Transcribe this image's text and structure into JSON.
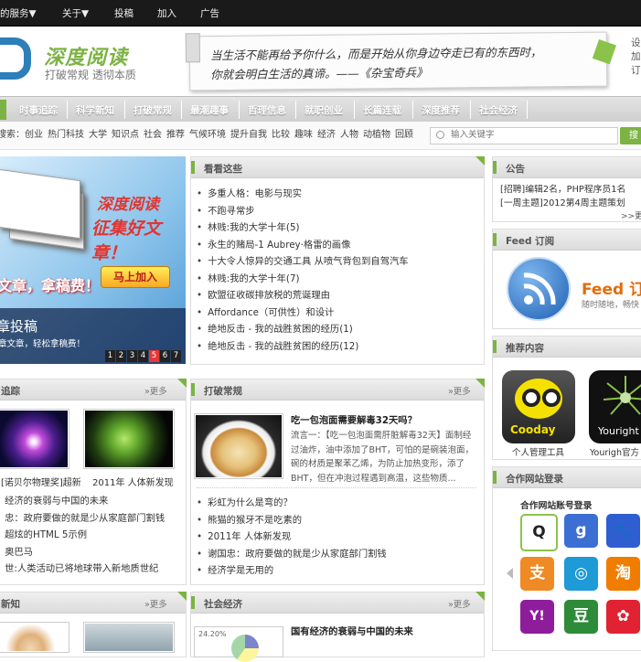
{
  "topnav": {
    "items": [
      "的服务▼",
      "关于▼",
      "投稿",
      "加入",
      "广告"
    ]
  },
  "header": {
    "logo_title": "深度阅读",
    "logo_sub": "打破常规 透彻本质",
    "quote_line1": "当生活不能再给予你什么，而是开始从你身边夺走已有的东西时，",
    "quote_line2": "你就会明白生活的真谛。——《杂宝奇兵》",
    "right_links": [
      "设",
      "加",
      "订"
    ]
  },
  "nav": {
    "items": [
      "时事追踪",
      "科学新知",
      "打破常规",
      "最潮趣事",
      "哲理信息",
      "就职创业",
      "长篇连载",
      "深度推荐",
      "社会经济"
    ]
  },
  "search": {
    "keywords_label": "搜索：",
    "keywords": [
      "创业",
      "热门科技",
      "大学",
      "知识点",
      "社会",
      "推荐",
      "气候环境",
      "提升自我",
      "比较",
      "趣味",
      "经济",
      "人物",
      "动植物",
      "回顾"
    ],
    "placeholder": "输入关键字",
    "button": "搜"
  },
  "banner": {
    "headline1": "深度阅读",
    "headline2": "征集好文章！",
    "left_text": "文章，拿稿费！",
    "join_button": "马上加入",
    "caption_title": "章投稿",
    "caption_sub": "章文章，轻松拿稿费！",
    "pages": [
      "1",
      "2",
      "3",
      "4",
      "5",
      "6",
      "7"
    ]
  },
  "kankan": {
    "title": "看看这些",
    "items": [
      "多重人格：电影与现实",
      "不跑寻常步",
      "林贱:我的大学十年(5)",
      "永生的赌局-1 Aubrey·格雷的画像",
      "十大令人惊异的交通工具 从喷气背包到自驾汽车",
      "林贱:我的大学十年(7)",
      "欧盟征收碳排放税的荒诞理由",
      "Affordance（可供性）和设计",
      "绝地反击 - 我的战胜贫困的经历(1)",
      "绝地反击 - 我的战胜贫困的经历(12)"
    ]
  },
  "notice": {
    "title": "公告",
    "items": [
      "[招聘]编辑2名，PHP程序员1名",
      "[一周主题]2012第4周主题策划"
    ],
    "more": ">>更"
  },
  "feed": {
    "title": "Feed 订阅",
    "logo": "Feed 订",
    "sub": "随时随地，畅快"
  },
  "recommend": {
    "title": "推荐内容",
    "apps": [
      "个人管理工具",
      "Yourigh官方"
    ],
    "app1_label": "Cooday",
    "app2_label": "Youright"
  },
  "shishi": {
    "title": "追踪",
    "more": "»更多",
    "thumb_caps": [
      "[诺贝尔物理奖]超新",
      "2011年 人体新发现"
    ],
    "items": [
      "经济的衰弱与中国的未来",
      "忠：政府要做的就是少从家庭部门割钱",
      "超炫的HTML 5示例",
      "奥巴马",
      "世:人类活动已将地球带入新地质世纪"
    ]
  },
  "dapo": {
    "title": "打破常规",
    "more": "»更多",
    "feature_title": "吃一包泡面需要解毒32天吗？",
    "feature_text": [
      "流言一：【吃一包泡面需肝脏解毒32天】面制经",
      "过油炸，油中添加了BHT，可怕的是碗装泡面，",
      "碗的材质是聚苯乙烯，为防止加热变形，添了",
      "BHT，但在冲泡过程遇到高温，这些物质..."
    ],
    "items": [
      "彩虹为什么是弯的？",
      "熊猫的猴牙不是吃素的",
      "2011年 人体新发现",
      "谢国忠：政府要做的就是少从家庭部门割钱",
      "经济学是无用的"
    ]
  },
  "shehui": {
    "title": "社会经济",
    "more": "»更多",
    "feature_title": "国有经济的衰弱与中国的未来",
    "chart_label": "24.20%"
  },
  "kexue": {
    "title": "新知",
    "more": "»更多"
  },
  "partner": {
    "title": "合作网站登录",
    "heading": "合作网站账号登录",
    "icons": [
      "Q",
      "g",
      "🐾",
      "支",
      "◎",
      "淘",
      "Y!",
      "豆",
      "✿"
    ]
  },
  "colors": {
    "accent": "#7cb342",
    "top": "#1a1a1a",
    "link_blue": "#2c7fb8"
  }
}
